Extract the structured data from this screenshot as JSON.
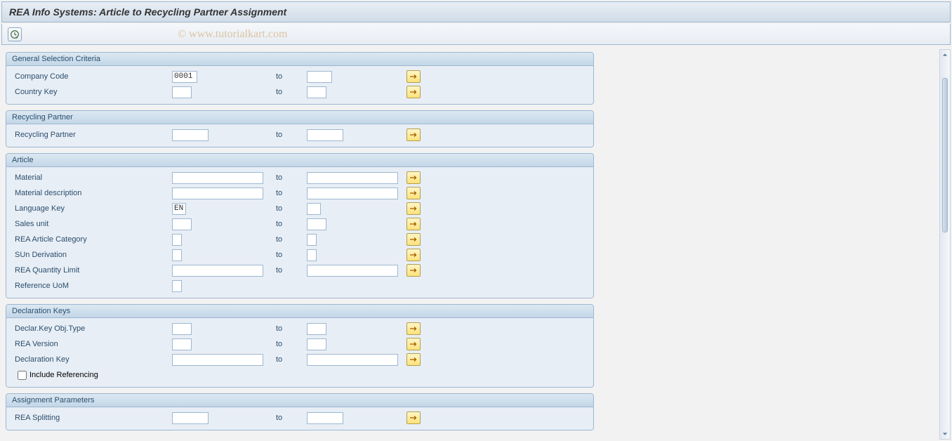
{
  "title": "REA Info Systems: Article to Recycling Partner Assignment",
  "watermark": "© www.tutorialkart.com",
  "to_label": "to",
  "sections": {
    "general": {
      "header": "General Selection Criteria",
      "company_code_label": "Company Code",
      "company_code_value": "0001",
      "country_key_label": "Country Key"
    },
    "recycling": {
      "header": "Recycling Partner",
      "recycling_partner_label": "Recycling Partner"
    },
    "article": {
      "header": "Article",
      "material_label": "Material",
      "material_desc_label": "Material description",
      "language_key_label": "Language Key",
      "language_key_value": "EN",
      "sales_unit_label": "Sales unit",
      "rea_article_cat_label": "REA Article Category",
      "sun_derivation_label": "SUn Derivation",
      "rea_qty_limit_label": "REA Quantity Limit",
      "reference_uom_label": "Reference UoM"
    },
    "declaration": {
      "header": "Declaration Keys",
      "declar_key_obj_type_label": "Declar.Key Obj.Type",
      "rea_version_label": "REA Version",
      "declaration_key_label": "Declaration Key",
      "include_referencing_label": "Include Referencing"
    },
    "assignment": {
      "header": "Assignment Parameters",
      "rea_splitting_label": "REA Splitting"
    }
  }
}
